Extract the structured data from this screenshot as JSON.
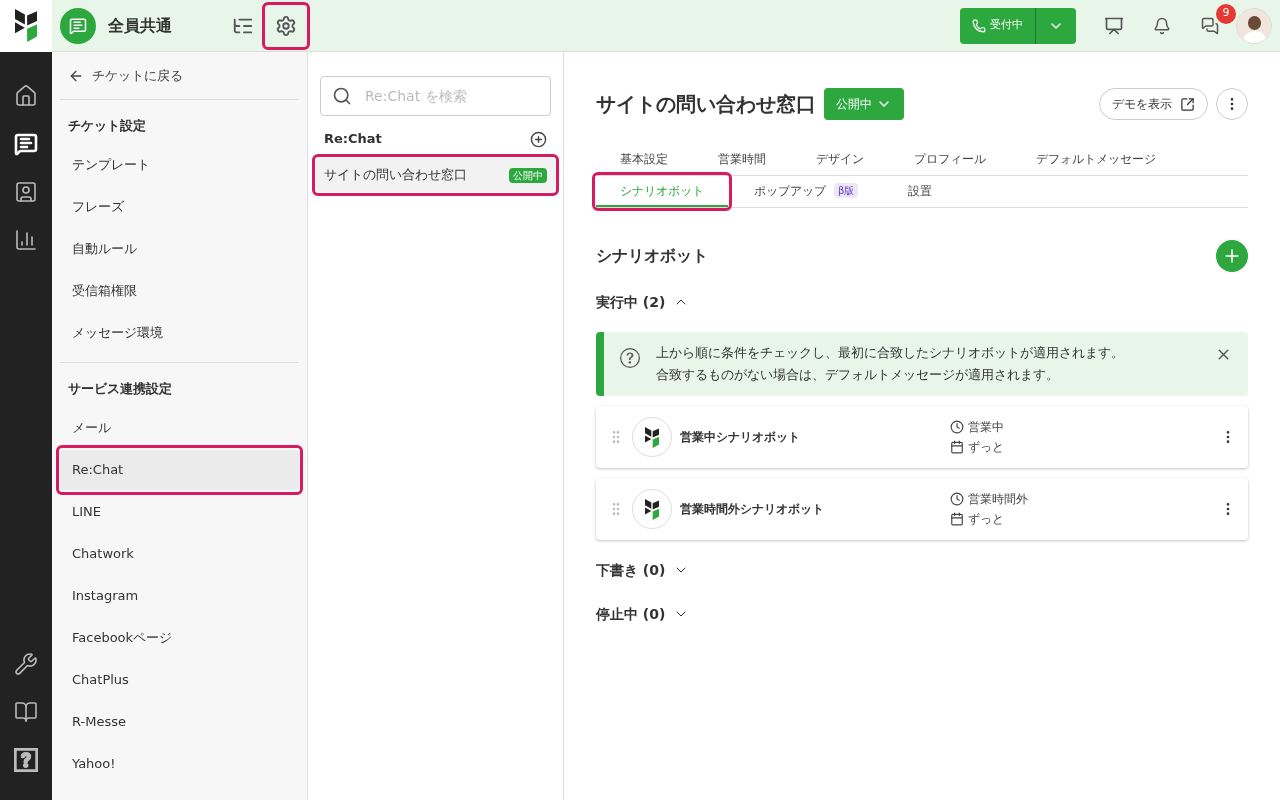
{
  "topbar": {
    "workspace": "全員共通",
    "gear_highlighted": true,
    "status_button": "受付中",
    "chat_badge": "9"
  },
  "rail": {
    "top": [
      {
        "selected": false
      },
      {
        "selected": true
      },
      {
        "selected": false
      },
      {
        "selected": false
      }
    ],
    "bottom": [
      {
        "selected": false
      },
      {
        "selected": false
      },
      {
        "selected": false
      }
    ]
  },
  "settings_nav": {
    "back": "チケットに戻る",
    "sections": [
      {
        "title": "チケット設定",
        "items": [
          {
            "label": "テンプレート",
            "selected": false,
            "highlighted": false
          },
          {
            "label": "フレーズ",
            "selected": false,
            "highlighted": false
          },
          {
            "label": "自動ルール",
            "selected": false,
            "highlighted": false
          },
          {
            "label": "受信箱権限",
            "selected": false,
            "highlighted": false
          },
          {
            "label": "メッセージ環境",
            "selected": false,
            "highlighted": false
          }
        ]
      },
      {
        "title": "サービス連携設定",
        "items": [
          {
            "label": "メール",
            "selected": false,
            "highlighted": false
          },
          {
            "label": "Re:Chat",
            "selected": true,
            "highlighted": true
          },
          {
            "label": "LINE",
            "selected": false,
            "highlighted": false
          },
          {
            "label": "Chatwork",
            "selected": false,
            "highlighted": false
          },
          {
            "label": "Instagram",
            "selected": false,
            "highlighted": false
          },
          {
            "label": "Facebookページ",
            "selected": false,
            "highlighted": false
          },
          {
            "label": "ChatPlus",
            "selected": false,
            "highlighted": false
          },
          {
            "label": "R-Messe",
            "selected": false,
            "highlighted": false
          },
          {
            "label": "Yahoo!",
            "selected": false,
            "highlighted": false
          }
        ]
      }
    ]
  },
  "channel_list": {
    "search_placeholder": "Re:Chat を検索",
    "header": "Re:Chat",
    "items": [
      {
        "label": "サイトの問い合わせ窓口",
        "badge": "公開中",
        "selected": true,
        "highlighted": true
      }
    ]
  },
  "main": {
    "title": "サイトの問い合わせ窓口",
    "status": "公開中",
    "demo_button": "デモを表示",
    "tab_rows": [
      [
        {
          "label": "基本設定",
          "selected": false,
          "highlighted": false
        },
        {
          "label": "営業時間",
          "selected": false,
          "highlighted": false
        },
        {
          "label": "デザイン",
          "selected": false,
          "highlighted": false
        },
        {
          "label": "プロフィール",
          "selected": false,
          "highlighted": false
        },
        {
          "label": "デフォルトメッセージ",
          "selected": false,
          "highlighted": false
        }
      ],
      [
        {
          "label": "シナリオボット",
          "selected": true,
          "highlighted": true
        },
        {
          "label": "ポップアップ",
          "badge": "β版",
          "selected": false,
          "highlighted": false
        },
        {
          "label": "設置",
          "selected": false,
          "highlighted": false
        }
      ]
    ],
    "section_title": "シナリオボット",
    "groups": [
      {
        "label": "実行中 (2)",
        "expanded": true,
        "info": [
          "上から順に条件をチェックし、最初に合致したシナリオボットが適用されます。",
          "合致するものがない場合は、デフォルトメッセージが適用されます。"
        ],
        "bots": [
          {
            "name": "営業中シナリオボット",
            "hours": "営業中",
            "period": "ずっと"
          },
          {
            "name": "営業時間外シナリオボット",
            "hours": "営業時間外",
            "period": "ずっと"
          }
        ]
      },
      {
        "label": "下書き (0)",
        "expanded": false
      },
      {
        "label": "停止中 (0)",
        "expanded": false
      }
    ]
  }
}
